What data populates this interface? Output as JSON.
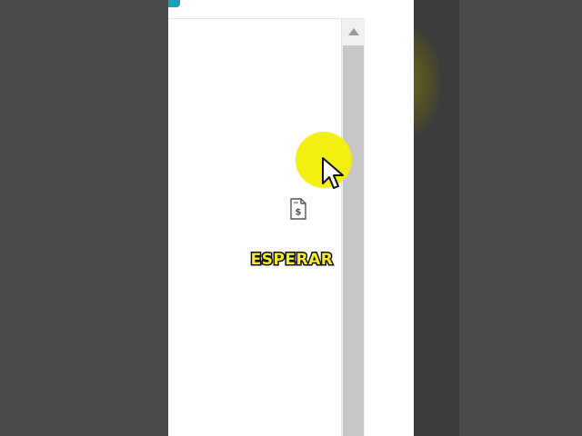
{
  "overlay": {
    "caption": "ESPERAR"
  },
  "icons": {
    "document": "invoice-dollar-icon",
    "cursor": "mouse-pointer-icon",
    "scroll_up": "triangle-up-icon"
  },
  "colors": {
    "highlight": "#f2ef11",
    "caption_fill": "#f7ee2a",
    "caption_stroke": "#111111",
    "accent_tab": "#17a2b8",
    "letterbox": "#4a4a4a"
  }
}
